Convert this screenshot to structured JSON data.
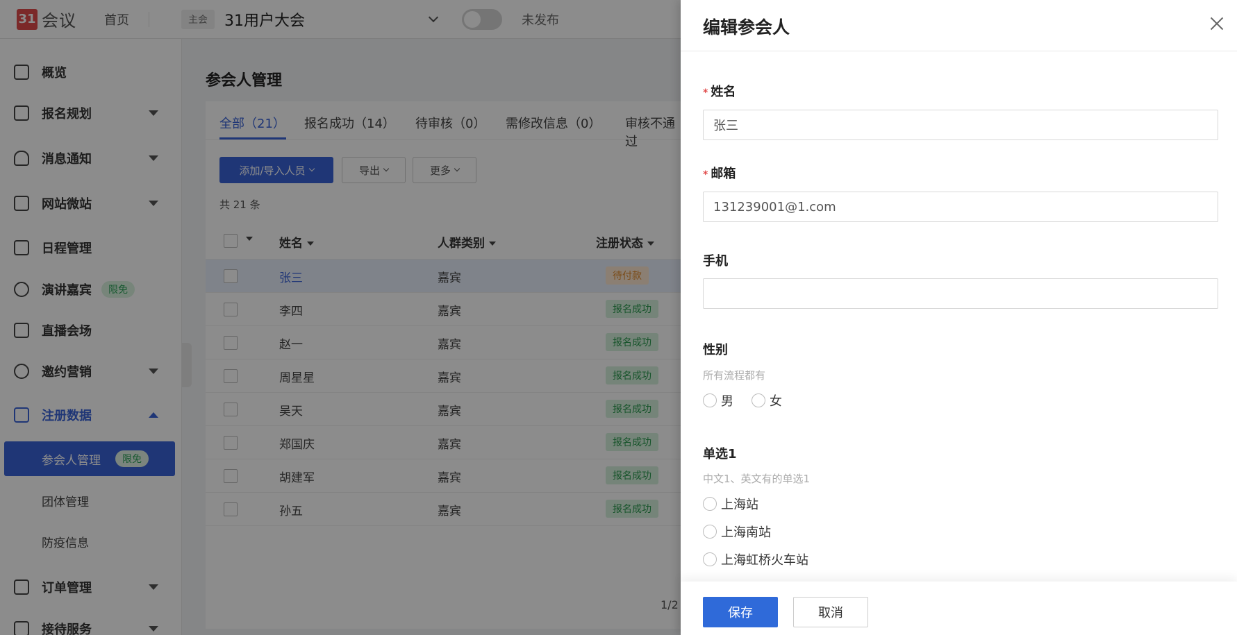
{
  "topbar": {
    "logo_mark": "31",
    "logo_text": "会议",
    "home": "首页",
    "main_tag": "主会",
    "event_title": "31用户大会",
    "publish_status": "未发布"
  },
  "sidebar": {
    "items": [
      {
        "label": "概览"
      },
      {
        "label": "报名规划"
      },
      {
        "label": "消息通知"
      },
      {
        "label": "网站微站"
      },
      {
        "label": "日程管理"
      },
      {
        "label": "演讲嘉宾",
        "badge": "限免"
      },
      {
        "label": "直播会场"
      },
      {
        "label": "邀约营销"
      },
      {
        "label": "注册数据"
      },
      {
        "label": "订单管理"
      },
      {
        "label": "接待服务"
      }
    ],
    "sub_items": [
      {
        "label": "参会人管理",
        "badge": "限免"
      },
      {
        "label": "团体管理"
      },
      {
        "label": "防疫信息"
      }
    ]
  },
  "main": {
    "page_title": "参会人管理",
    "tabs": [
      {
        "label": "全部（21）"
      },
      {
        "label": "报名成功（14）"
      },
      {
        "label": "待审核（0）"
      },
      {
        "label": "需修改信息（0）"
      },
      {
        "label": "审核不通过"
      }
    ],
    "buttons": {
      "add_import": "添加/导入人员",
      "export": "导出",
      "more": "更多"
    },
    "total": "共 21 条",
    "columns": [
      "姓名",
      "人群类别",
      "注册状态"
    ],
    "rows": [
      {
        "name": "张三",
        "category": "嘉宾",
        "status": "待付款"
      },
      {
        "name": "李四",
        "category": "嘉宾",
        "status": "报名成功"
      },
      {
        "name": "赵一",
        "category": "嘉宾",
        "status": "报名成功"
      },
      {
        "name": "周星星",
        "category": "嘉宾",
        "status": "报名成功"
      },
      {
        "name": "吴天",
        "category": "嘉宾",
        "status": "报名成功"
      },
      {
        "name": "郑国庆",
        "category": "嘉宾",
        "status": "报名成功"
      },
      {
        "name": "胡建军",
        "category": "嘉宾",
        "status": "报名成功"
      },
      {
        "name": "孙五",
        "category": "嘉宾",
        "status": "报名成功"
      }
    ],
    "pagination": "1/2"
  },
  "drawer": {
    "title": "编辑参会人",
    "required_mark": "*",
    "name_label": "姓名",
    "name_value": "张三",
    "email_label": "邮箱",
    "email_value": "131239001@1.com",
    "phone_label": "手机",
    "phone_value": "",
    "gender_label": "性别",
    "gender_hint": "所有流程都有",
    "gender_options": [
      "男",
      "女"
    ],
    "single1_label": "单选1",
    "single1_hint": "中文1、英文有的单选1",
    "single1_options": [
      "上海站",
      "上海南站",
      "上海虹桥火车站"
    ],
    "save": "保存",
    "cancel": "取消"
  },
  "colors": {
    "accent": "#3a63d8",
    "primary_button": "#2f6ad9",
    "success": "#2b9a4f",
    "pending": "#e08a2e",
    "required": "#e14b4b"
  }
}
